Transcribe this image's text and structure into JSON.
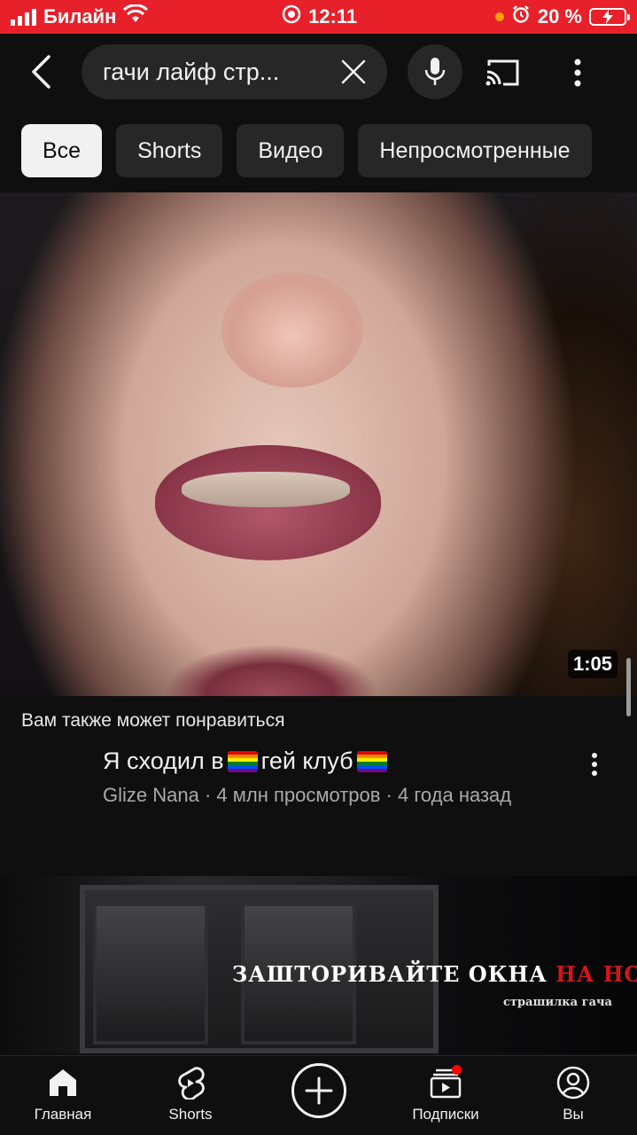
{
  "status_bar": {
    "carrier": "Билайн",
    "time": "12:11",
    "battery_percent": "20 %",
    "colors": {
      "background": "#e8202a"
    }
  },
  "search": {
    "query": "гачи лайф стр...",
    "icons": [
      "back-arrow-icon",
      "clear-icon",
      "microphone-icon",
      "cast-icon",
      "more-vertical-icon"
    ]
  },
  "filters": [
    {
      "label": "Все",
      "active": true
    },
    {
      "label": "Shorts",
      "active": false
    },
    {
      "label": "Видео",
      "active": false
    },
    {
      "label": "Непросмотренные",
      "active": false
    }
  ],
  "video": {
    "duration": "1:05",
    "section_label": "Вам также может понравиться",
    "title_before": "Я сходил в",
    "title_after": "гей клуб",
    "meta": "Glize Nana · 4 млн просмотров · 4 года назад"
  },
  "next_video": {
    "overlay_white": "ЗАШТОРИВАЙТЕ ОКНА",
    "overlay_red": "НА НОЧЬ",
    "overlay_sub": "страшилка гача"
  },
  "bottom_nav": {
    "home": "Главная",
    "shorts": "Shorts",
    "subscriptions": "Подписки",
    "you": "Вы"
  },
  "colors": {
    "background": "#0f0f0f",
    "chip": "#272727",
    "chip_active": "#f1f1f1",
    "notification": "#ff0000"
  }
}
